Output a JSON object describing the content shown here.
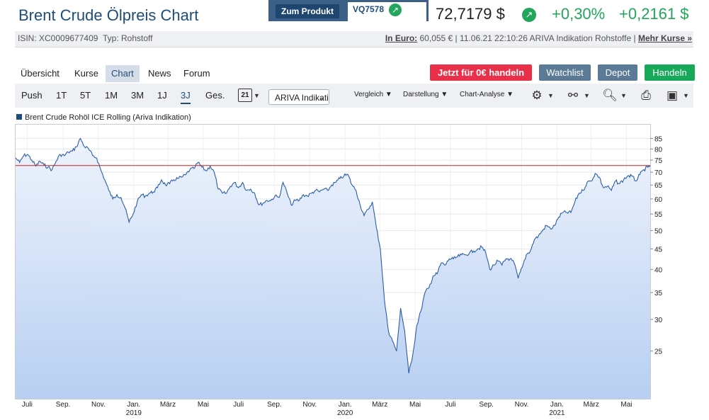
{
  "header": {
    "title": "Brent Crude Ölpreis Chart",
    "product_button": "Zum Produkt",
    "product_code": "VQ7578",
    "price": "72,7179 $",
    "change_pct": "+0,30%",
    "change_abs": "+0,2161 $",
    "accent_color": "#1e4d7b",
    "positive_color": "#21a65b"
  },
  "info": {
    "isin": "ISIN: XC0009677409",
    "type": "Typ: Rohstoff",
    "euro_label": "In Euro:",
    "quote_detail": " 60,055 € | 11.06.21 22:10:26 ARIVA Indikation Rohstoffe | ",
    "more_quotes": "Mehr Kurse »"
  },
  "tabs": [
    "Übersicht",
    "Kurse",
    "Chart",
    "News",
    "Forum"
  ],
  "active_tab": "Chart",
  "actions": {
    "trade": "Jetzt für 0€ handeln",
    "watchlist": "Watchlist",
    "depot": "Depot",
    "handeln": "Handeln"
  },
  "toolbar": {
    "ranges": [
      "Push",
      "1T",
      "5T",
      "1M",
      "3M",
      "1J",
      "3J",
      "Ges."
    ],
    "active_range": "3J",
    "calendar_day": "21",
    "source_select": "ARIVA Indikation",
    "menus": [
      "Vergleich",
      "Darstellung",
      "Chart-Analyse"
    ],
    "icons": [
      "gear-icon",
      "indicator-icon",
      "zoom-icon",
      "print-icon",
      "save-icon"
    ]
  },
  "chart_data": {
    "type": "area",
    "legend": "Brent Crude Rohöl ICE Rolling (Ariva Indikation)",
    "y_scale": "log",
    "ylim": [
      19,
      92
    ],
    "y_ticks": [
      25,
      30,
      35,
      40,
      45,
      50,
      55,
      60,
      65,
      70,
      75,
      80,
      85
    ],
    "x_labels": [
      {
        "date": "2018-07-01",
        "label": "Juli",
        "year": ""
      },
      {
        "date": "2018-09-01",
        "label": "Sep.",
        "year": ""
      },
      {
        "date": "2018-11-01",
        "label": "Nov.",
        "year": ""
      },
      {
        "date": "2019-01-01",
        "label": "Jan.",
        "year": "2019"
      },
      {
        "date": "2019-03-01",
        "label": "März",
        "year": ""
      },
      {
        "date": "2019-05-01",
        "label": "Mai",
        "year": ""
      },
      {
        "date": "2019-07-01",
        "label": "Juli",
        "year": ""
      },
      {
        "date": "2019-09-01",
        "label": "Sep.",
        "year": ""
      },
      {
        "date": "2019-11-01",
        "label": "Nov.",
        "year": ""
      },
      {
        "date": "2020-01-01",
        "label": "Jan.",
        "year": "2020"
      },
      {
        "date": "2020-03-01",
        "label": "März",
        "year": ""
      },
      {
        "date": "2020-05-01",
        "label": "Mai",
        "year": ""
      },
      {
        "date": "2020-07-01",
        "label": "Juli",
        "year": ""
      },
      {
        "date": "2020-09-01",
        "label": "Sep.",
        "year": ""
      },
      {
        "date": "2020-11-01",
        "label": "Nov.",
        "year": ""
      },
      {
        "date": "2021-01-01",
        "label": "Jan.",
        "year": "2021"
      },
      {
        "date": "2021-03-01",
        "label": "März",
        "year": ""
      },
      {
        "date": "2021-05-01",
        "label": "Mai",
        "year": ""
      }
    ],
    "x_range": [
      "2018-06-11",
      "2021-06-11"
    ],
    "reference_line": 72.72,
    "line_color": "#2a5ea8",
    "reference_color": "#cc2222",
    "series": [
      {
        "points": [
          [
            "2018-06-11",
            76
          ],
          [
            "2018-06-18",
            74
          ],
          [
            "2018-06-25",
            77
          ],
          [
            "2018-07-02",
            77.5
          ],
          [
            "2018-07-09",
            75
          ],
          [
            "2018-07-16",
            72.5
          ],
          [
            "2018-07-23",
            74.5
          ],
          [
            "2018-07-30",
            73
          ],
          [
            "2018-08-06",
            72
          ],
          [
            "2018-08-13",
            71
          ],
          [
            "2018-08-20",
            74.5
          ],
          [
            "2018-08-27",
            77.5
          ],
          [
            "2018-09-03",
            77
          ],
          [
            "2018-09-10",
            78.5
          ],
          [
            "2018-09-17",
            79
          ],
          [
            "2018-09-24",
            81
          ],
          [
            "2018-10-01",
            85
          ],
          [
            "2018-10-08",
            81
          ],
          [
            "2018-10-15",
            80
          ],
          [
            "2018-10-22",
            77
          ],
          [
            "2018-10-29",
            76
          ],
          [
            "2018-11-05",
            71
          ],
          [
            "2018-11-12",
            67
          ],
          [
            "2018-11-19",
            63
          ],
          [
            "2018-11-26",
            60
          ],
          [
            "2018-12-03",
            61.5
          ],
          [
            "2018-12-10",
            60.5
          ],
          [
            "2018-12-17",
            57
          ],
          [
            "2018-12-24",
            52.5
          ],
          [
            "2018-12-31",
            55
          ],
          [
            "2019-01-07",
            59
          ],
          [
            "2019-01-14",
            61.5
          ],
          [
            "2019-01-21",
            61
          ],
          [
            "2019-01-28",
            62
          ],
          [
            "2019-02-04",
            62.5
          ],
          [
            "2019-02-11",
            64
          ],
          [
            "2019-02-18",
            67
          ],
          [
            "2019-02-25",
            65
          ],
          [
            "2019-03-04",
            65.5
          ],
          [
            "2019-03-11",
            67
          ],
          [
            "2019-03-18",
            67.5
          ],
          [
            "2019-03-25",
            68
          ],
          [
            "2019-04-01",
            69
          ],
          [
            "2019-04-08",
            71
          ],
          [
            "2019-04-15",
            71.5
          ],
          [
            "2019-04-22",
            74
          ],
          [
            "2019-04-29",
            72
          ],
          [
            "2019-05-06",
            70.5
          ],
          [
            "2019-05-13",
            72.5
          ],
          [
            "2019-05-20",
            70
          ],
          [
            "2019-05-27",
            63.5
          ],
          [
            "2019-06-03",
            62
          ],
          [
            "2019-06-10",
            62
          ],
          [
            "2019-06-17",
            64.5
          ],
          [
            "2019-06-24",
            66
          ],
          [
            "2019-07-01",
            64
          ],
          [
            "2019-07-08",
            66
          ],
          [
            "2019-07-15",
            63
          ],
          [
            "2019-07-22",
            63.5
          ],
          [
            "2019-07-29",
            62
          ],
          [
            "2019-08-05",
            58
          ],
          [
            "2019-08-12",
            58.5
          ],
          [
            "2019-08-19",
            59.5
          ],
          [
            "2019-08-26",
            59.5
          ],
          [
            "2019-09-02",
            61
          ],
          [
            "2019-09-09",
            60.5
          ],
          [
            "2019-09-16",
            66
          ],
          [
            "2019-09-23",
            62
          ],
          [
            "2019-09-30",
            58
          ],
          [
            "2019-10-07",
            59.5
          ],
          [
            "2019-10-14",
            59.5
          ],
          [
            "2019-10-21",
            61.5
          ],
          [
            "2019-10-28",
            61
          ],
          [
            "2019-11-04",
            62
          ],
          [
            "2019-11-11",
            63
          ],
          [
            "2019-11-18",
            62.5
          ],
          [
            "2019-11-25",
            63.5
          ],
          [
            "2019-12-02",
            63
          ],
          [
            "2019-12-09",
            65
          ],
          [
            "2019-12-16",
            66
          ],
          [
            "2019-12-23",
            67.5
          ],
          [
            "2019-12-30",
            68.5
          ],
          [
            "2020-01-06",
            69
          ],
          [
            "2020-01-13",
            65
          ],
          [
            "2020-01-20",
            63
          ],
          [
            "2020-01-27",
            58
          ],
          [
            "2020-02-03",
            54.5
          ],
          [
            "2020-02-10",
            56.5
          ],
          [
            "2020-02-17",
            59
          ],
          [
            "2020-02-24",
            51
          ],
          [
            "2020-03-02",
            45
          ],
          [
            "2020-03-09",
            33.5
          ],
          [
            "2020-03-16",
            28
          ],
          [
            "2020-03-23",
            26.5
          ],
          [
            "2020-03-30",
            25
          ],
          [
            "2020-04-06",
            32
          ],
          [
            "2020-04-13",
            28
          ],
          [
            "2020-04-20",
            22
          ],
          [
            "2020-04-27",
            24.5
          ],
          [
            "2020-05-04",
            29
          ],
          [
            "2020-05-11",
            31.5
          ],
          [
            "2020-05-18",
            35
          ],
          [
            "2020-05-25",
            36
          ],
          [
            "2020-06-01",
            38.5
          ],
          [
            "2020-06-08",
            39
          ],
          [
            "2020-06-15",
            41.5
          ],
          [
            "2020-06-22",
            41
          ],
          [
            "2020-06-29",
            42.5
          ],
          [
            "2020-07-06",
            42.5
          ],
          [
            "2020-07-13",
            43
          ],
          [
            "2020-07-20",
            43.5
          ],
          [
            "2020-07-27",
            43.5
          ],
          [
            "2020-08-03",
            44
          ],
          [
            "2020-08-10",
            44.5
          ],
          [
            "2020-08-17",
            45
          ],
          [
            "2020-08-24",
            45.5
          ],
          [
            "2020-08-31",
            44
          ],
          [
            "2020-09-07",
            40
          ],
          [
            "2020-09-14",
            41
          ],
          [
            "2020-09-21",
            42
          ],
          [
            "2020-09-28",
            41
          ],
          [
            "2020-10-05",
            42.5
          ],
          [
            "2020-10-12",
            42.5
          ],
          [
            "2020-10-19",
            41.5
          ],
          [
            "2020-10-26",
            38
          ],
          [
            "2020-11-02",
            40.5
          ],
          [
            "2020-11-09",
            43.5
          ],
          [
            "2020-11-16",
            44.5
          ],
          [
            "2020-11-23",
            47.5
          ],
          [
            "2020-11-30",
            48.5
          ],
          [
            "2020-12-07",
            50
          ],
          [
            "2020-12-14",
            51.5
          ],
          [
            "2020-12-21",
            50.5
          ],
          [
            "2020-12-28",
            51.5
          ],
          [
            "2021-01-04",
            54
          ],
          [
            "2021-01-11",
            55.5
          ],
          [
            "2021-01-18",
            55.5
          ],
          [
            "2021-01-25",
            55.5
          ],
          [
            "2021-02-01",
            59
          ],
          [
            "2021-02-08",
            62
          ],
          [
            "2021-02-15",
            63
          ],
          [
            "2021-02-22",
            66
          ],
          [
            "2021-03-01",
            66.5
          ],
          [
            "2021-03-08",
            69.5
          ],
          [
            "2021-03-15",
            68
          ],
          [
            "2021-03-22",
            64
          ],
          [
            "2021-03-29",
            64.5
          ],
          [
            "2021-04-05",
            63
          ],
          [
            "2021-04-12",
            66.5
          ],
          [
            "2021-04-19",
            65.5
          ],
          [
            "2021-04-26",
            67
          ],
          [
            "2021-05-03",
            68.5
          ],
          [
            "2021-05-10",
            68.5
          ],
          [
            "2021-05-17",
            66.5
          ],
          [
            "2021-05-24",
            69
          ],
          [
            "2021-05-31",
            71
          ],
          [
            "2021-06-07",
            72
          ],
          [
            "2021-06-11",
            72.72
          ]
        ]
      }
    ]
  }
}
